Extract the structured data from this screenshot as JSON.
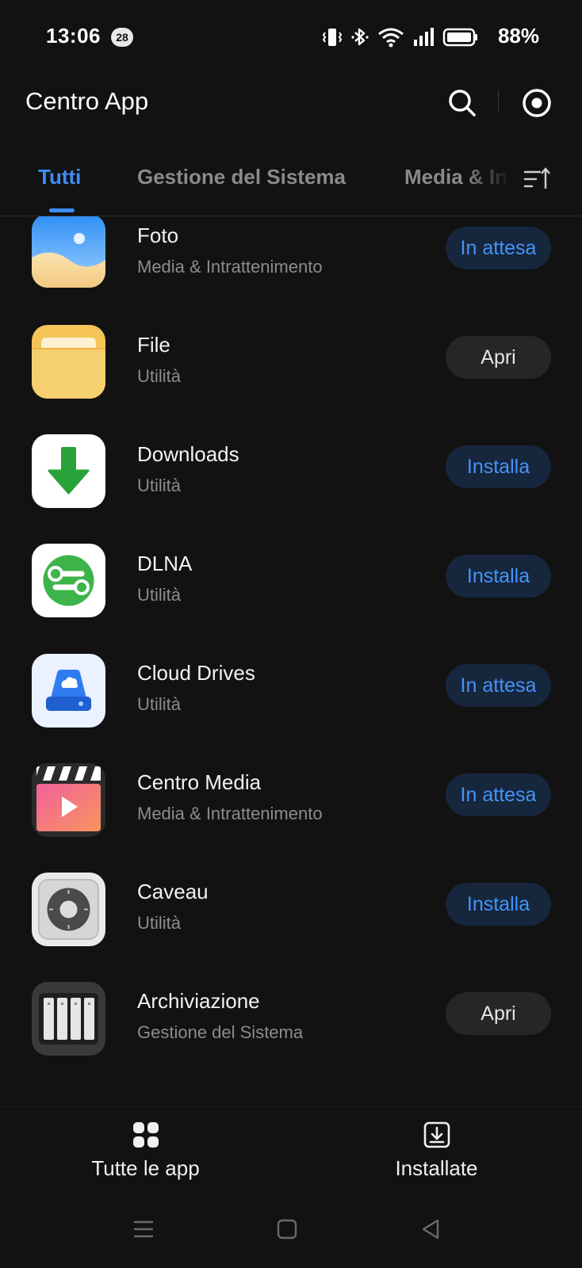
{
  "status_bar": {
    "time": "13:06",
    "notification_count": "28",
    "battery": "88%",
    "icons": [
      "vibrate-icon",
      "bluetooth-icon",
      "wifi-icon",
      "signal-icon",
      "battery-icon"
    ]
  },
  "header": {
    "title": "Centro App",
    "icons": [
      "search-icon",
      "settings-icon"
    ]
  },
  "tabs": [
    {
      "label": "Tutti",
      "active": true
    },
    {
      "label": "Gestione del Sistema",
      "active": false
    },
    {
      "label": "Media & In",
      "active": false
    }
  ],
  "apps": [
    {
      "name": "Foto",
      "category": "Media & Intrattenimento",
      "action": "In attesa",
      "icon": "photos-icon"
    },
    {
      "name": "File",
      "category": "Utilità",
      "action": "Apri",
      "icon": "folder-icon"
    },
    {
      "name": "Downloads",
      "category": "Utilità",
      "action": "Installa",
      "icon": "download-arrow-icon"
    },
    {
      "name": "DLNA",
      "category": "Utilità",
      "action": "Installa",
      "icon": "dlna-icon"
    },
    {
      "name": "Cloud Drives",
      "category": "Utilità",
      "action": "In attesa",
      "icon": "cloud-drive-icon"
    },
    {
      "name": "Centro Media",
      "category": "Media & Intrattenimento",
      "action": "In attesa",
      "icon": "clapperboard-icon"
    },
    {
      "name": "Caveau",
      "category": "Utilità",
      "action": "Installa",
      "icon": "safe-icon"
    },
    {
      "name": "Archiviazione",
      "category": "Gestione del Sistema",
      "action": "Apri",
      "icon": "storage-icon"
    }
  ],
  "bottom_nav": [
    {
      "label": "Tutte le app",
      "icon": "grid-icon"
    },
    {
      "label": "Installate",
      "icon": "installed-icon"
    }
  ],
  "colors": {
    "background": "#121212",
    "accent": "#3d8df5",
    "pending_button_bg": "#16263d",
    "open_button_bg": "#262626"
  }
}
